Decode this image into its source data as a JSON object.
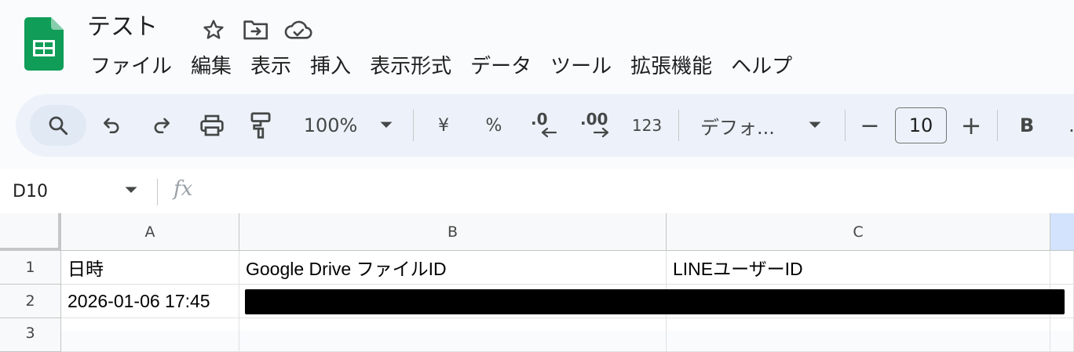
{
  "app": {
    "title": "テスト",
    "brand_color": "#0f9d58",
    "title_icons": [
      "star-icon",
      "move-to-folder-icon",
      "cloud-saved-icon"
    ]
  },
  "menu": {
    "items": [
      "ファイル",
      "編集",
      "表示",
      "挿入",
      "表示形式",
      "データ",
      "ツール",
      "拡張機能",
      "ヘルプ"
    ]
  },
  "toolbar": {
    "zoom": "100%",
    "currency": "¥",
    "percent": "%",
    "decrease_decimal": ".0",
    "increase_decimal": ".00",
    "number_format": "123",
    "font": "デフォ...",
    "minus": "−",
    "font_size": "10",
    "plus": "+",
    "bold": "B"
  },
  "formula_bar": {
    "name_box": "D10",
    "fx_label": "fx",
    "formula": ""
  },
  "sheet": {
    "columns": [
      "A",
      "B",
      "C"
    ],
    "rows": [
      {
        "num": "1",
        "cells": [
          "日時",
          "Google Drive ファイルID",
          "LINEユーザーID"
        ]
      },
      {
        "num": "2",
        "cells": [
          "2026-01-06 17:45",
          "",
          ""
        ],
        "redacted": true
      },
      {
        "num": "3",
        "cells": [
          "",
          "",
          ""
        ]
      }
    ]
  }
}
